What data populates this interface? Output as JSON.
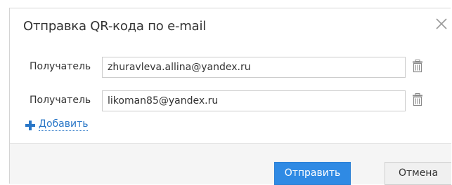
{
  "dialog": {
    "title": "Отправка QR-кода по e-mail",
    "close_icon": "close-icon"
  },
  "recipients": [
    {
      "label": "Получатель",
      "value": "zhuravleva.allina@yandex.ru"
    },
    {
      "label": "Получатель",
      "value": "likoman85@yandex.ru"
    }
  ],
  "add_link": {
    "label": "Добавить",
    "icon": "plus-icon"
  },
  "footer": {
    "send_label": "Отправить",
    "cancel_label": "Отмена"
  },
  "colors": {
    "accent": "#2f8ae4",
    "link": "#2a77c7",
    "footer_bg": "#f5f5f5"
  }
}
